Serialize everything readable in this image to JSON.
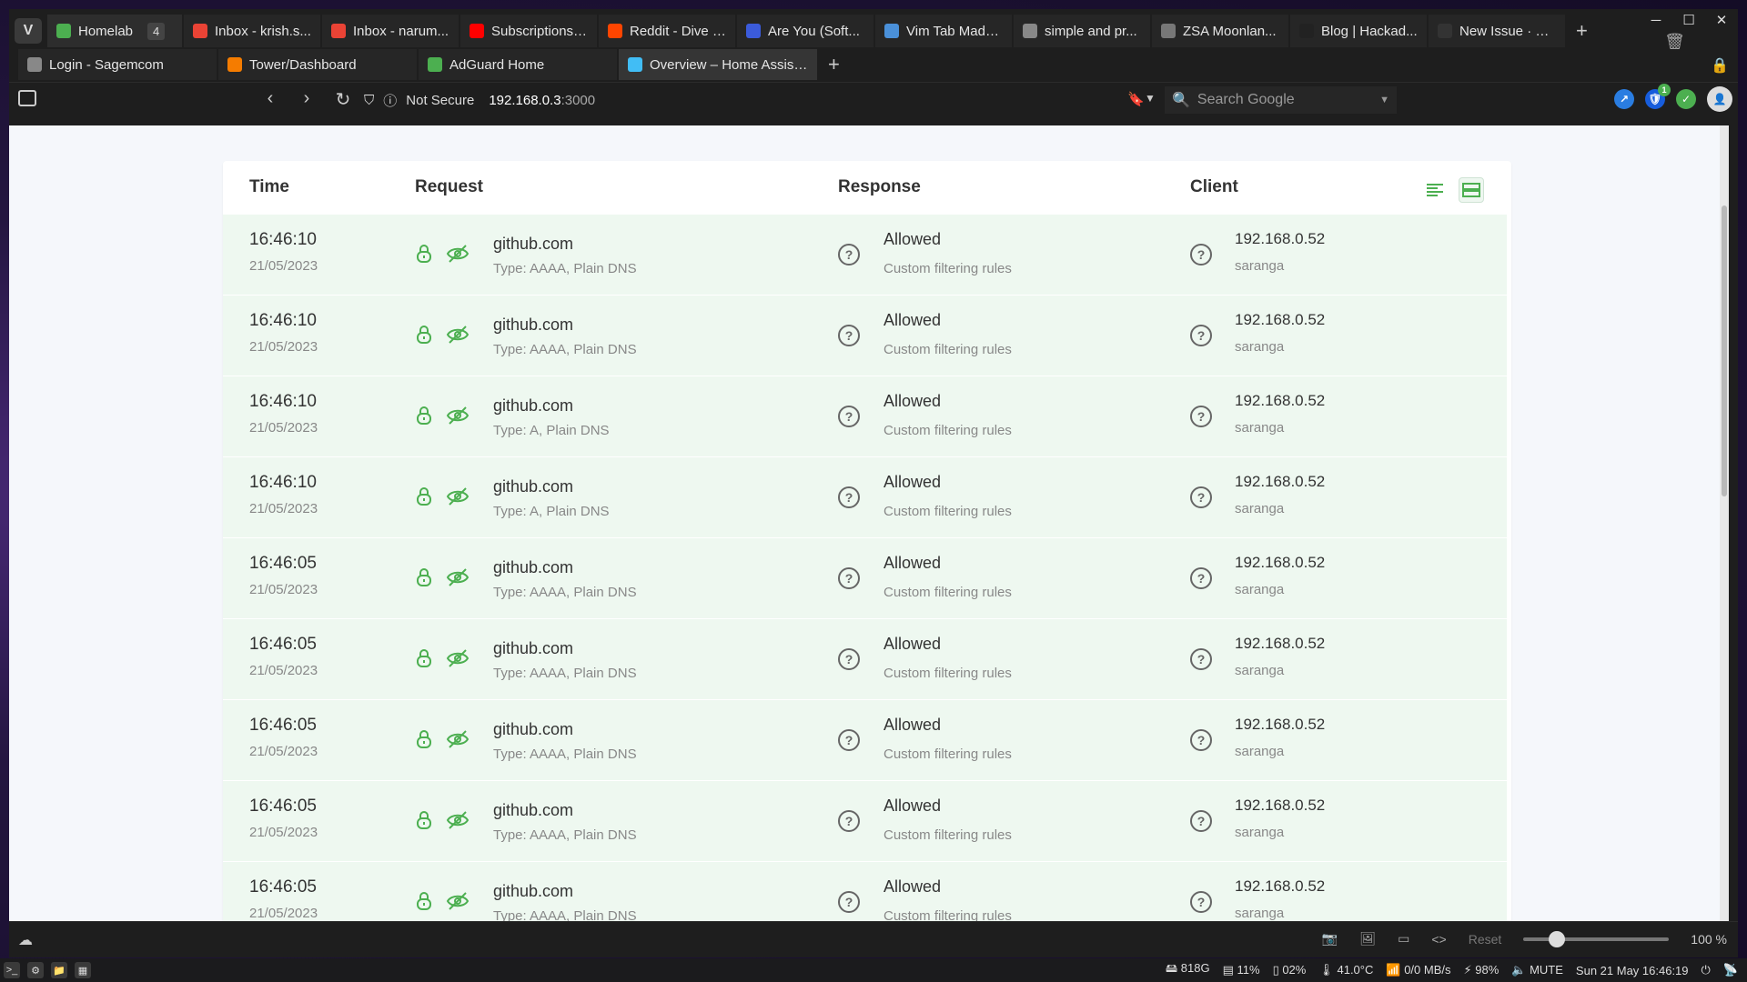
{
  "browser": {
    "tabs_top": [
      {
        "label": "Homelab",
        "count": "4",
        "fav": "adguard-icon",
        "color": "#4caf50"
      },
      {
        "label": "Inbox - krish.s...",
        "fav": "gmail-icon",
        "color": "#ea4335"
      },
      {
        "label": "Inbox - narum...",
        "fav": "gmail-icon",
        "color": "#ea4335"
      },
      {
        "label": "Subscriptions ...",
        "fav": "youtube-icon",
        "color": "#ff0000"
      },
      {
        "label": "Reddit - Dive i...",
        "fav": "reddit-icon",
        "color": "#ff4500"
      },
      {
        "label": "Are You (Soft...",
        "fav": "infinity-icon",
        "color": "#3b5bdb"
      },
      {
        "label": "Vim Tab Madn...",
        "fav": "jd-icon",
        "color": "#4a90d9"
      },
      {
        "label": "simple and pr...",
        "fav": "document-icon",
        "color": "#888888"
      },
      {
        "label": "ZSA Moonlan...",
        "fav": "zsa-icon",
        "color": "#777777"
      },
      {
        "label": "Blog | Hackad...",
        "fav": "hackaday-icon",
        "color": "#222222"
      },
      {
        "label": "New Issue · La...",
        "fav": "github-icon",
        "color": "#333333"
      }
    ],
    "tabs_second": [
      {
        "label": "Login - Sagemcom",
        "fav": "document-icon",
        "color": "#888888"
      },
      {
        "label": "Tower/Dashboard",
        "fav": "unraid-icon",
        "color": "#f57c00"
      },
      {
        "label": "AdGuard Home",
        "fav": "adguard-icon",
        "color": "#4caf50"
      },
      {
        "label": "Overview – Home Assist...",
        "fav": "home-assistant-icon",
        "color": "#41bdf5"
      }
    ],
    "address": {
      "not_secure": "Not Secure",
      "host": "192.168.0.3",
      "port": ":3000"
    },
    "search_placeholder": "Search Google",
    "ext_badge": "1",
    "zoom_reset": "Reset",
    "zoom_level": "100 %"
  },
  "table": {
    "headers": {
      "time": "Time",
      "request": "Request",
      "response": "Response",
      "client": "Client"
    },
    "rows": [
      {
        "time": "16:46:10",
        "date": "21/05/2023",
        "domain": "github.com",
        "type": "Type: AAAA, Plain DNS",
        "status": "Allowed",
        "rule": "Custom filtering rules",
        "ip": "192.168.0.52",
        "client": "saranga"
      },
      {
        "time": "16:46:10",
        "date": "21/05/2023",
        "domain": "github.com",
        "type": "Type: AAAA, Plain DNS",
        "status": "Allowed",
        "rule": "Custom filtering rules",
        "ip": "192.168.0.52",
        "client": "saranga"
      },
      {
        "time": "16:46:10",
        "date": "21/05/2023",
        "domain": "github.com",
        "type": "Type: A, Plain DNS",
        "status": "Allowed",
        "rule": "Custom filtering rules",
        "ip": "192.168.0.52",
        "client": "saranga"
      },
      {
        "time": "16:46:10",
        "date": "21/05/2023",
        "domain": "github.com",
        "type": "Type: A, Plain DNS",
        "status": "Allowed",
        "rule": "Custom filtering rules",
        "ip": "192.168.0.52",
        "client": "saranga"
      },
      {
        "time": "16:46:05",
        "date": "21/05/2023",
        "domain": "github.com",
        "type": "Type: AAAA, Plain DNS",
        "status": "Allowed",
        "rule": "Custom filtering rules",
        "ip": "192.168.0.52",
        "client": "saranga"
      },
      {
        "time": "16:46:05",
        "date": "21/05/2023",
        "domain": "github.com",
        "type": "Type: AAAA, Plain DNS",
        "status": "Allowed",
        "rule": "Custom filtering rules",
        "ip": "192.168.0.52",
        "client": "saranga"
      },
      {
        "time": "16:46:05",
        "date": "21/05/2023",
        "domain": "github.com",
        "type": "Type: AAAA, Plain DNS",
        "status": "Allowed",
        "rule": "Custom filtering rules",
        "ip": "192.168.0.52",
        "client": "saranga"
      },
      {
        "time": "16:46:05",
        "date": "21/05/2023",
        "domain": "github.com",
        "type": "Type: AAAA, Plain DNS",
        "status": "Allowed",
        "rule": "Custom filtering rules",
        "ip": "192.168.0.52",
        "client": "saranga"
      },
      {
        "time": "16:46:05",
        "date": "21/05/2023",
        "domain": "github.com",
        "type": "Type: AAAA, Plain DNS",
        "status": "Allowed",
        "rule": "Custom filtering rules",
        "ip": "192.168.0.52",
        "client": "saranga"
      }
    ]
  },
  "taskbar": {
    "disk": "818G",
    "cpu": "11%",
    "mem": "02%",
    "temp": "41.0°C",
    "net": "0/0 MB/s",
    "battery": "98%",
    "volume": "MUTE",
    "clock": "Sun 21 May 16:46:19"
  },
  "colors": {
    "accent_green": "#4caf50",
    "row_bg": "#eef8f0"
  }
}
